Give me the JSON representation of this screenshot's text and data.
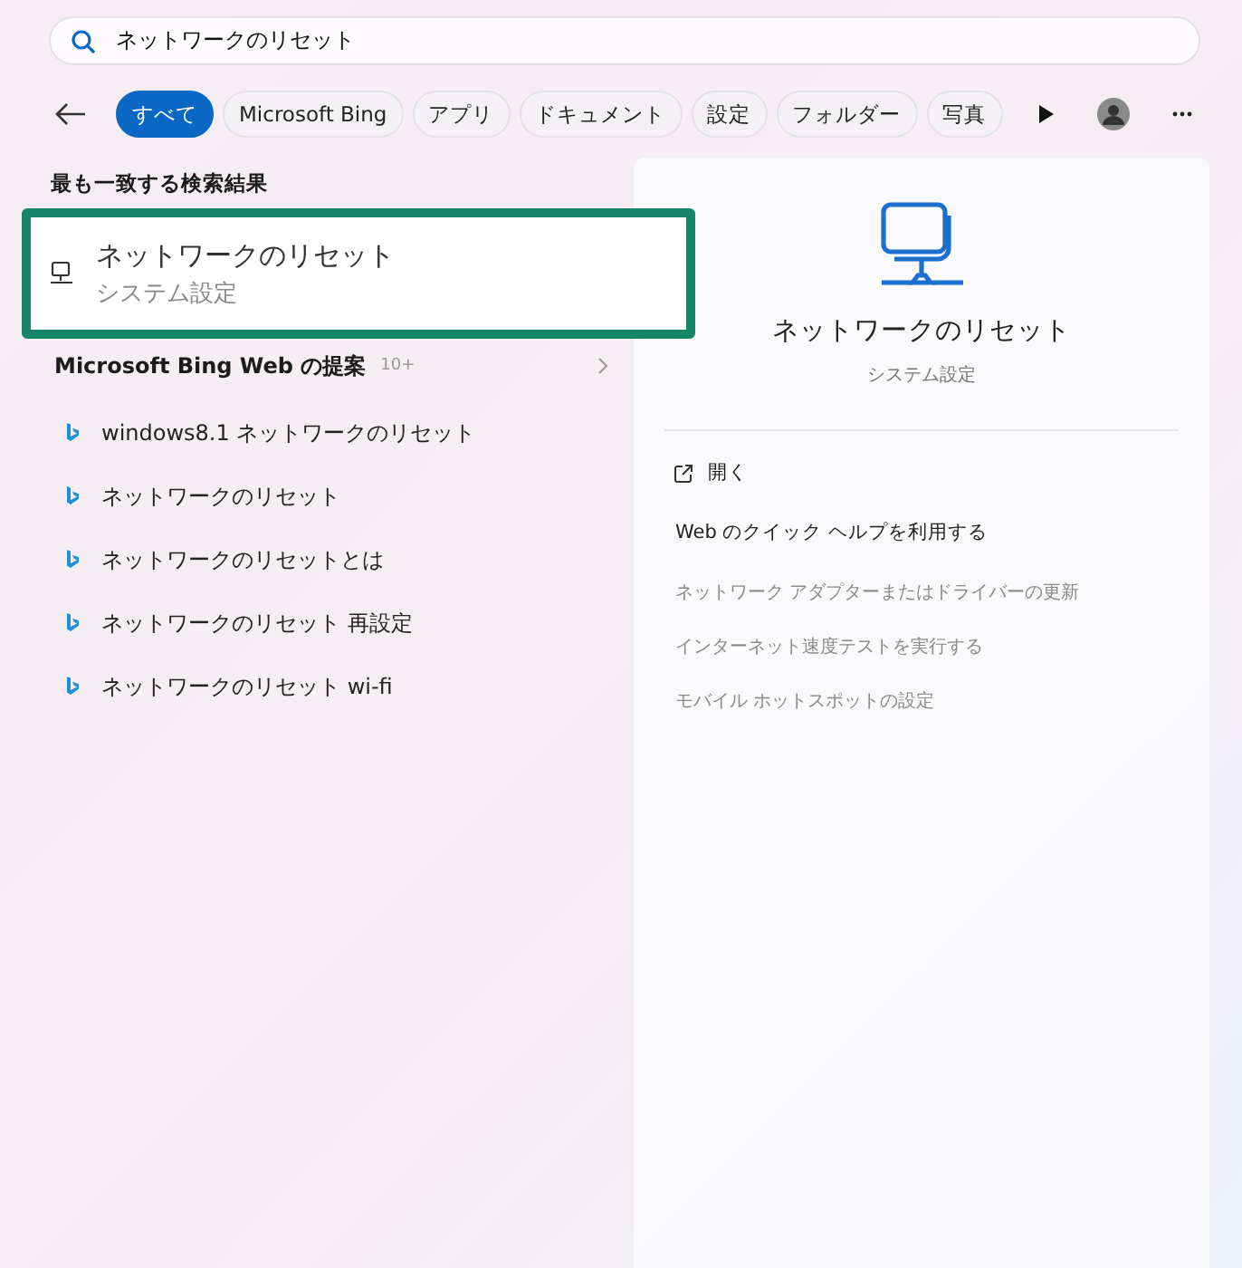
{
  "search": {
    "value": "ネットワークのリセット"
  },
  "filters": [
    {
      "label": "すべて",
      "selected": true
    },
    {
      "label": "Microsoft Bing",
      "selected": false
    },
    {
      "label": "アプリ",
      "selected": false
    },
    {
      "label": "ドキュメント",
      "selected": false
    },
    {
      "label": "設定",
      "selected": false
    },
    {
      "label": "フォルダー",
      "selected": false
    },
    {
      "label": "写真",
      "selected": false
    }
  ],
  "best_match": {
    "heading": "最も一致する検索結果",
    "title": "ネットワークのリセット",
    "subtitle": "システム設定",
    "highlighted": true
  },
  "suggestions": {
    "heading": "Microsoft Bing Web の提案",
    "count": "10+",
    "items": [
      "windows8.1 ネットワークのリセット",
      "ネットワークのリセット",
      "ネットワークのリセットとは",
      "ネットワークのリセット 再設定",
      "ネットワークのリセット wi-fi"
    ]
  },
  "detail": {
    "title": "ネットワークのリセット",
    "subtitle": "システム設定",
    "open_label": "開く",
    "help_heading": "Web のクイック ヘルプを利用する",
    "help_items": [
      "ネットワーク アダプターまたはドライバーの更新",
      "インターネット速度テストを実行する",
      "モバイル ホットスポットの設定"
    ]
  }
}
